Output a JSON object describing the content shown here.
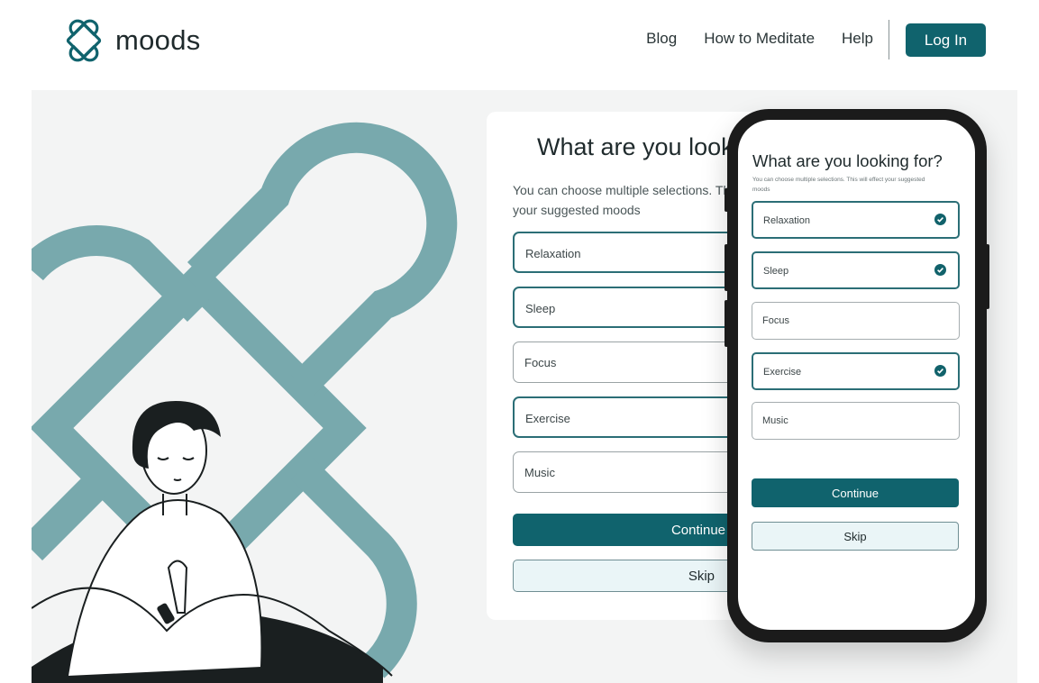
{
  "brand": {
    "name": "moods",
    "logo_icon": "interlocking-loops-logo"
  },
  "nav": {
    "links": [
      "Blog",
      "How to Meditate",
      "Help"
    ],
    "login_label": "Log In"
  },
  "colors": {
    "primary": "#10636d",
    "accent_light": "#eaf5f7",
    "illustration": "#78a9ad",
    "background": "#f3f4f4"
  },
  "desktop_form": {
    "title": "What are you looking for?",
    "subtitle": "You can choose multiple selections. This will effect your suggested moods",
    "options": [
      {
        "label": "Relaxation",
        "selected": true
      },
      {
        "label": "Sleep",
        "selected": true
      },
      {
        "label": "Focus",
        "selected": false
      },
      {
        "label": "Exercise",
        "selected": true
      },
      {
        "label": "Music",
        "selected": false
      }
    ],
    "continue_label": "Continue",
    "skip_label": "Skip"
  },
  "mobile_form": {
    "title": "What are you looking for?",
    "subtitle": "You can choose multiple selections. This will effect your suggested moods",
    "options": [
      {
        "label": "Relaxation",
        "selected": true
      },
      {
        "label": "Sleep",
        "selected": true
      },
      {
        "label": "Focus",
        "selected": false
      },
      {
        "label": "Exercise",
        "selected": true
      },
      {
        "label": "Music",
        "selected": false
      }
    ],
    "continue_label": "Continue",
    "skip_label": "Skip"
  }
}
